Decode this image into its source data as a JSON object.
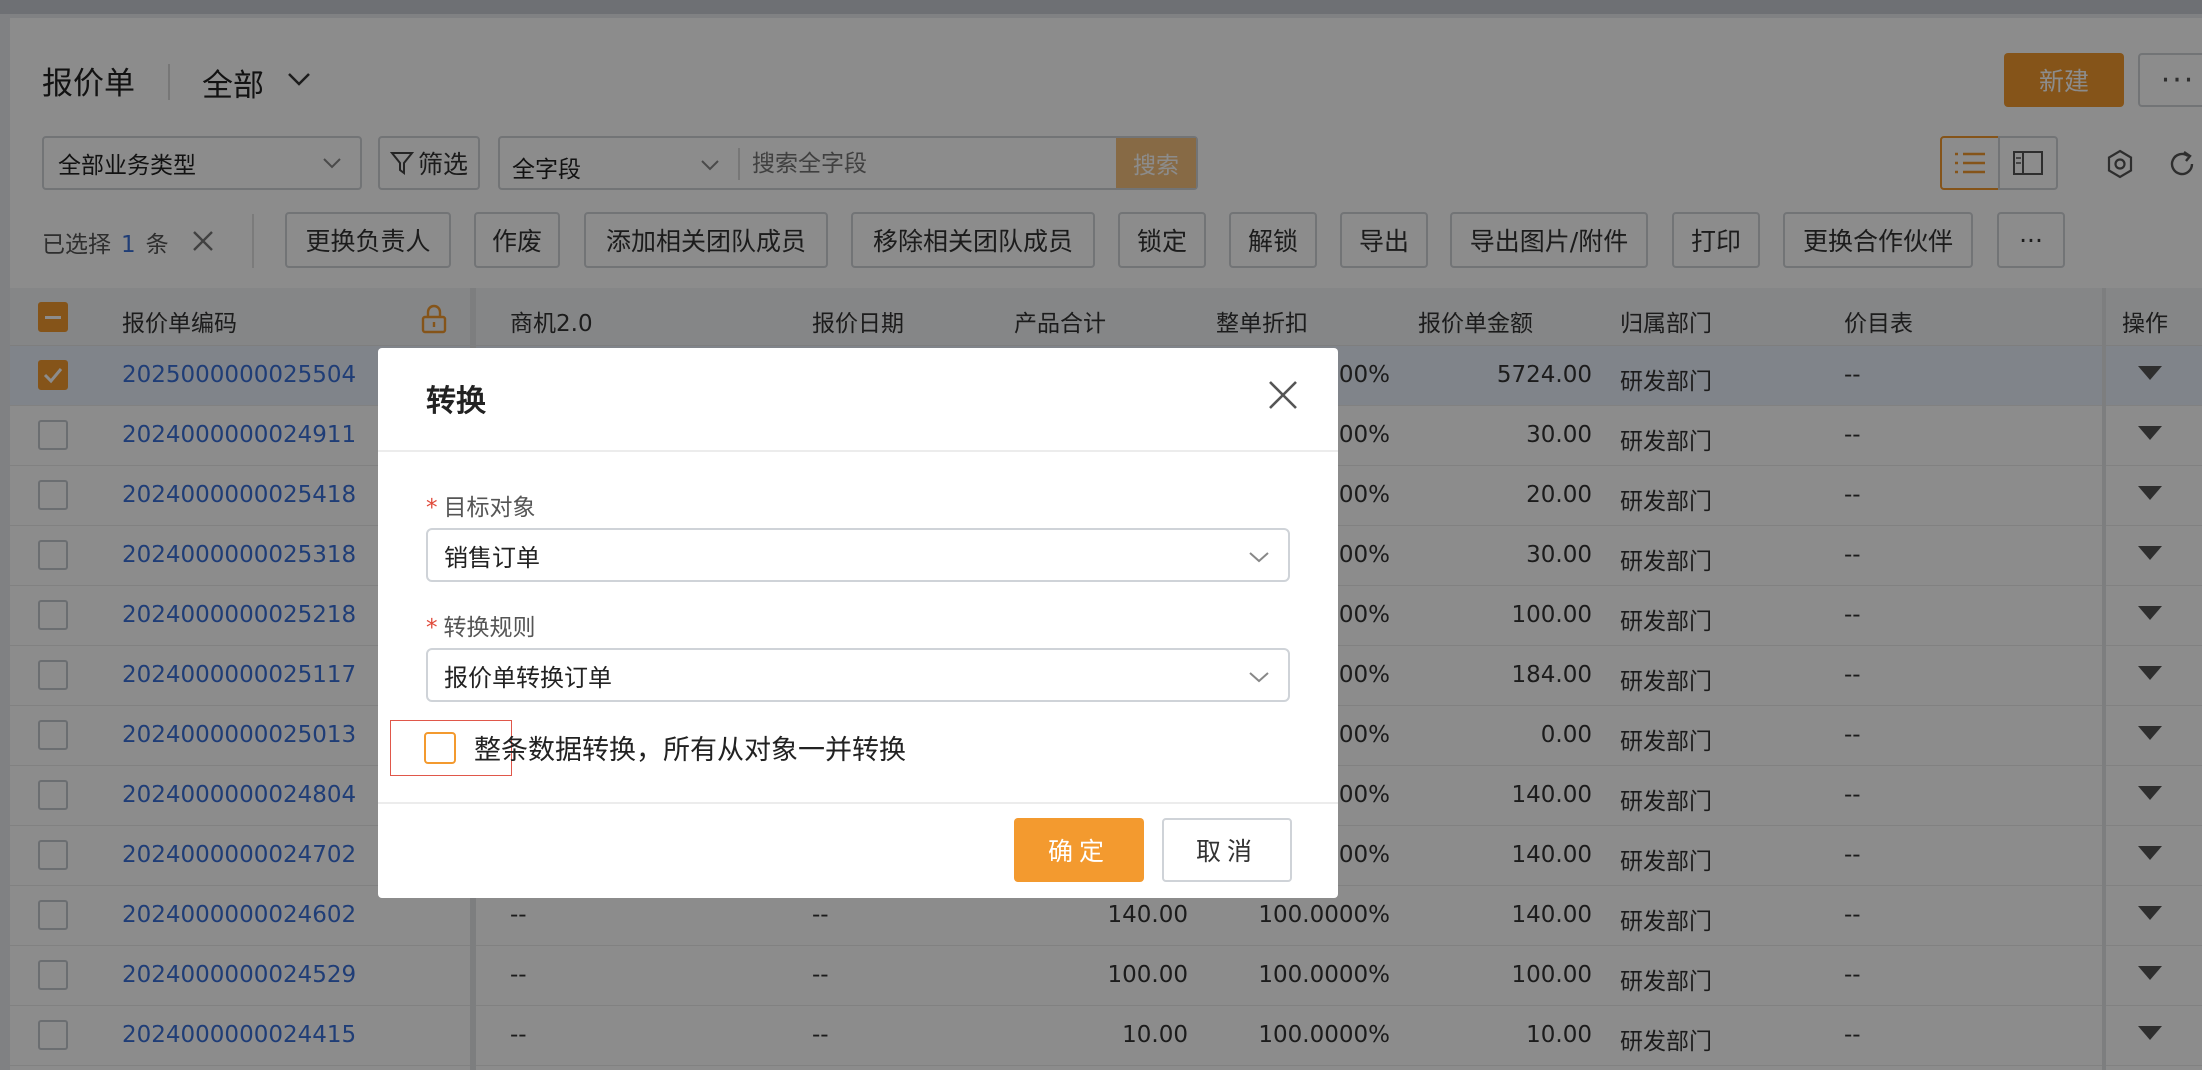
{
  "header": {
    "title": "报价单",
    "view": "全部",
    "new_label": "新建",
    "more_label": "···"
  },
  "toolbar": {
    "biz_type": "全部业务类型",
    "filter_label": "筛选",
    "search_field": "全字段",
    "search_placeholder": "搜索全字段",
    "search_btn": "搜索"
  },
  "batch": {
    "selected_prefix": "已选择",
    "selected_count": "1",
    "selected_suffix": "条",
    "actions": [
      "更换负责人",
      "作废",
      "添加相关团队成员",
      "移除相关团队成员",
      "锁定",
      "解锁",
      "导出",
      "导出图片/附件",
      "打印",
      "更换合作伙伴",
      "···"
    ]
  },
  "table": {
    "columns": [
      "报价单编码",
      "商机2.0",
      "报价日期",
      "产品合计",
      "整单折扣",
      "报价单金额",
      "归属部门",
      "价目表",
      "操作"
    ],
    "rows": [
      {
        "code": "2025000000025504",
        "opp": "",
        "date": "",
        "total": "",
        "discount": "00%",
        "amount": "5724.00",
        "dept": "研发部门",
        "price": "--",
        "checked": true
      },
      {
        "code": "2024000000024911",
        "opp": "",
        "date": "",
        "total": "",
        "discount": "00%",
        "amount": "30.00",
        "dept": "研发部门",
        "price": "--"
      },
      {
        "code": "2024000000025418",
        "opp": "",
        "date": "",
        "total": "",
        "discount": "00%",
        "amount": "20.00",
        "dept": "研发部门",
        "price": "--"
      },
      {
        "code": "2024000000025318",
        "opp": "",
        "date": "",
        "total": "",
        "discount": "00%",
        "amount": "30.00",
        "dept": "研发部门",
        "price": "--"
      },
      {
        "code": "2024000000025218",
        "opp": "",
        "date": "",
        "total": "",
        "discount": "00%",
        "amount": "100.00",
        "dept": "研发部门",
        "price": "--"
      },
      {
        "code": "2024000000025117",
        "opp": "",
        "date": "",
        "total": "",
        "discount": "00%",
        "amount": "184.00",
        "dept": "研发部门",
        "price": "--"
      },
      {
        "code": "2024000000025013",
        "opp": "",
        "date": "",
        "total": "",
        "discount": "00%",
        "amount": "0.00",
        "dept": "研发部门",
        "price": "--"
      },
      {
        "code": "2024000000024804",
        "opp": "",
        "date": "",
        "total": "",
        "discount": "00%",
        "amount": "140.00",
        "dept": "研发部门",
        "price": "--"
      },
      {
        "code": "2024000000024702",
        "opp": "",
        "date": "",
        "total": "",
        "discount": "00%",
        "amount": "140.00",
        "dept": "研发部门",
        "price": "--"
      },
      {
        "code": "2024000000024602",
        "opp": "--",
        "date": "--",
        "total": "140.00",
        "discount": "100.0000%",
        "amount": "140.00",
        "dept": "研发部门",
        "price": "--"
      },
      {
        "code": "2024000000024529",
        "opp": "--",
        "date": "--",
        "total": "100.00",
        "discount": "100.0000%",
        "amount": "100.00",
        "dept": "研发部门",
        "price": "--"
      },
      {
        "code": "2024000000024415",
        "opp": "--",
        "date": "--",
        "total": "10.00",
        "discount": "100.0000%",
        "amount": "10.00",
        "dept": "研发部门",
        "price": "--"
      }
    ]
  },
  "modal": {
    "title": "转换",
    "target_label": "目标对象",
    "target_value": "销售订单",
    "rule_label": "转换规则",
    "rule_value": "报价单转换订单",
    "checkbox_label": "整条数据转换，所有从对象一并转换",
    "required_mark": "*",
    "ok_label": "确定",
    "cancel_label": "取消"
  },
  "colors": {
    "accent": "#f39a2f",
    "link": "#3a6fd8"
  }
}
